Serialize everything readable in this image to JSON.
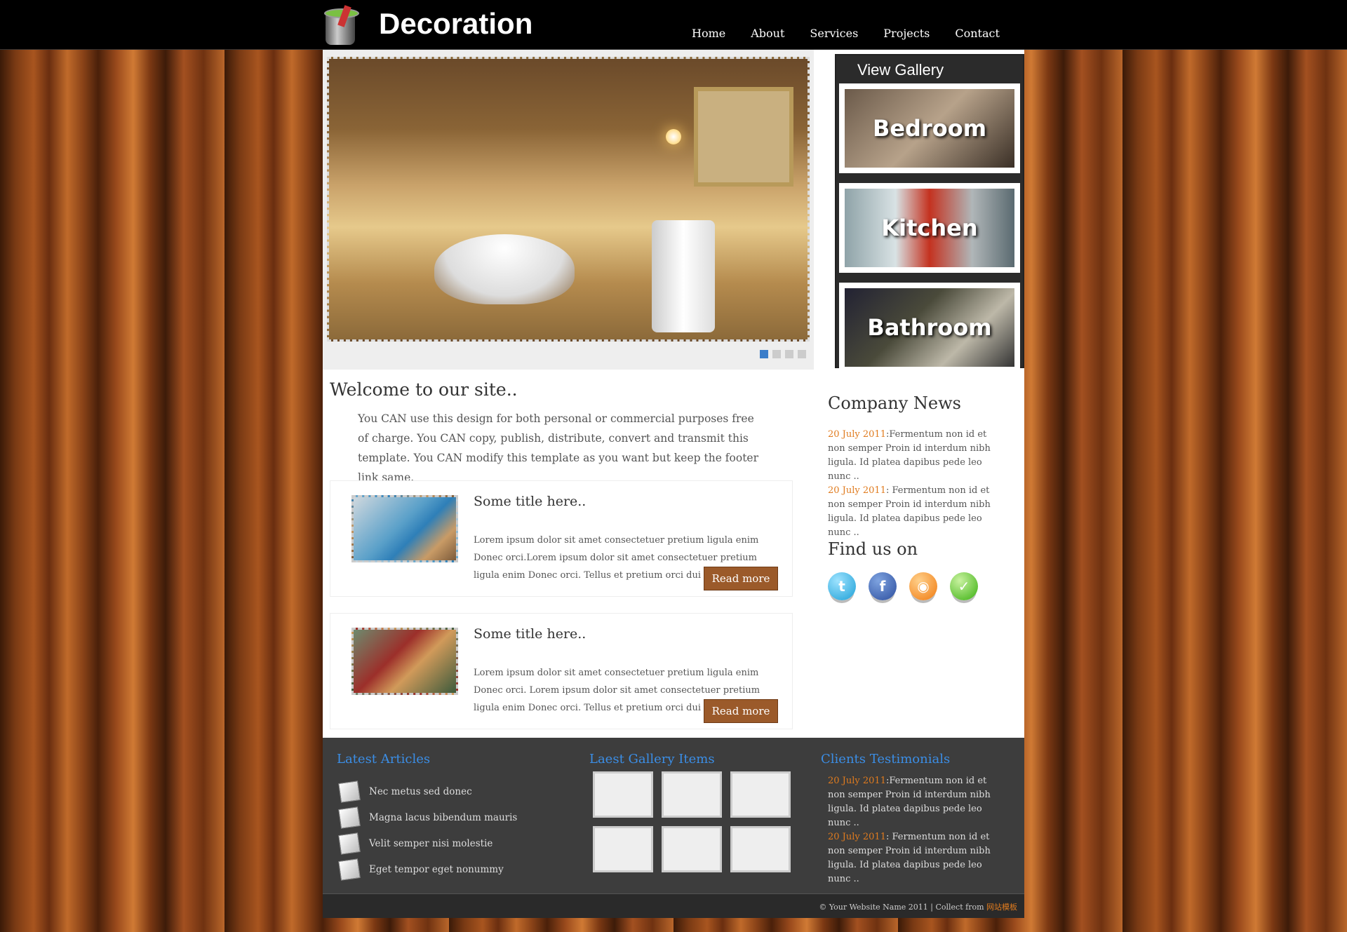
{
  "header": {
    "site_title": "Decoration",
    "nav": [
      "Home",
      "About",
      "Services",
      "Projects",
      "Contact"
    ]
  },
  "slider": {
    "dots": 4,
    "active_dot": 1
  },
  "gallery": {
    "title": "View Gallery",
    "items": [
      "Bedroom",
      "Kitchen",
      "Bathroom"
    ]
  },
  "welcome": {
    "title": "Welcome to our site..",
    "text": "You CAN use this design for both personal or commercial purposes free of charge. You CAN copy, publish, distribute, convert and transmit this template. You CAN modify this template as you want but keep the footer link same."
  },
  "posts": [
    {
      "title": "Some title here..",
      "text": "Lorem ipsum dolor sit amet consectetuer pretium ligula enim Donec orci.Lorem ipsum dolor sit amet consectetuer pretium ligula enim Donec orci. Tellus et pretium orci dui lorem ...",
      "button": "Read more"
    },
    {
      "title": "Some title here..",
      "text": "Lorem ipsum dolor sit amet consectetuer pretium ligula enim Donec orci. Lorem ipsum dolor sit amet consectetuer pretium ligula enim Donec orci. Tellus et pretium orci dui lorem ...",
      "button": "Read more"
    }
  ],
  "news": {
    "title": "Company News",
    "items": [
      {
        "date": "20 July 2011",
        "sep": ":",
        "text": "Fermentum non id et non semper Proin id interdum nibh ligula. Id platea dapibus pede leo nunc .."
      },
      {
        "date": "20 July 2011",
        "sep": ": ",
        "text": "Fermentum non id et non semper Proin id interdum nibh ligula. Id platea dapibus pede leo nunc .."
      }
    ]
  },
  "find_us": {
    "title": "Find us on",
    "icons": [
      "twitter-icon",
      "facebook-icon",
      "rss-icon",
      "green-check-icon"
    ]
  },
  "footer": {
    "latest_articles": {
      "title": "Latest Articles",
      "items": [
        "Nec metus sed donec",
        "Magna lacus bibendum mauris",
        "Velit semper nisi molestie",
        "Eget tempor eget nonummy"
      ]
    },
    "gallery_items_title": "Laest Gallery Items",
    "testimonials": {
      "title": "Clients Testimonials",
      "items": [
        {
          "date": "20 July 2011",
          "sep": ":",
          "text": "Fermentum non id et non semper Proin id interdum nibh ligula. Id platea dapibus pede leo nunc .."
        },
        {
          "date": "20 July 2011",
          "sep": ": ",
          "text": "Fermentum non id et non semper Proin id interdum nibh ligula. Id platea dapibus pede leo nunc .."
        }
      ]
    },
    "copyright": "© Your Website Name 2011 | Collect from ",
    "copyright_link": "网站模板"
  },
  "colors": {
    "accent_orange": "#e07b1e",
    "footer_heading_blue": "#3b8ee6",
    "button_brown": "#9b5a2a",
    "active_dot_blue": "#3b7dc9"
  }
}
